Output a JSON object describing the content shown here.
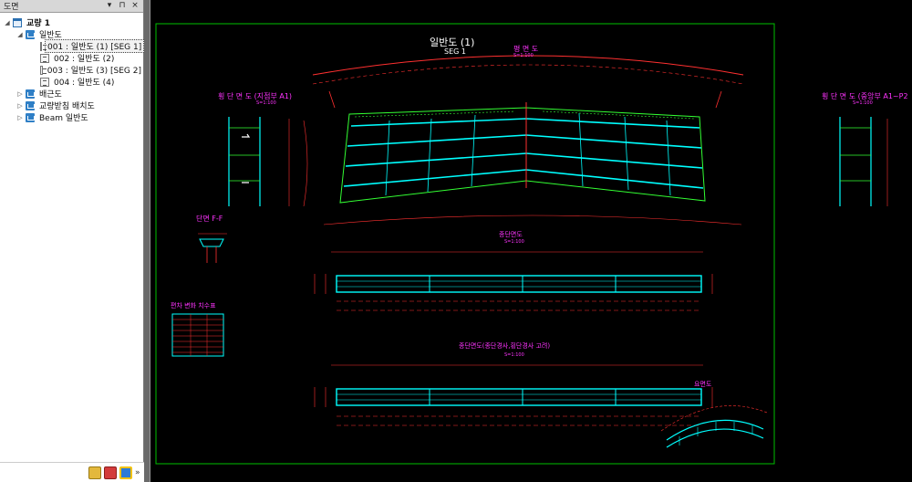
{
  "panel": {
    "title": "도면",
    "controls": [
      "▾",
      "⊓",
      "×"
    ]
  },
  "tree": {
    "root": "교량 1",
    "general": "일반도",
    "items": [
      "001 : 일반도 (1) [SEG 1]",
      "002 : 일반도 (2)",
      "003 : 일반도 (3) [SEG 2]",
      "004 : 일반도 (4)"
    ],
    "rebar": "배근도",
    "bearing": "교량받침 배치도",
    "beam": "Beam 일반도"
  },
  "drawing": {
    "title": "일반도 (1)",
    "subtitle": "SEG 1",
    "plan_view": "평 면 도",
    "cross_left": "횡 단 면 도 (지점부 A1)",
    "cross_right": "횡 단 면 도 (중앙부 A1~P2",
    "section": "단면 F-F",
    "table_title": "편차 변화 치수표",
    "longitudinal": "종단면도",
    "longitudinal_slope": "종단면도(종단경사,횡단경사 고려)",
    "side_view": "요면도",
    "scale": "S=1:100"
  },
  "colors": {
    "frame": "#00c000",
    "title": "#ffffff",
    "label": "#ff33ff",
    "deck": "#00ffff",
    "line": "#ff3030",
    "detail": "#33ff33"
  }
}
